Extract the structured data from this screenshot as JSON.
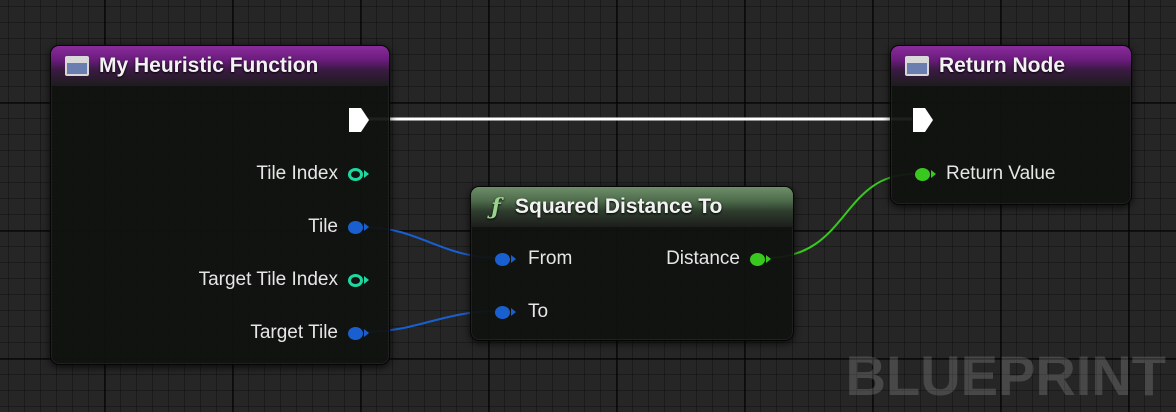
{
  "watermark": "BLUEPRINT",
  "entry_node": {
    "title": "My Heuristic Function",
    "pins": [
      {
        "label": "Tile Index",
        "type": "integer",
        "color": "#1fd8a0",
        "filled": false
      },
      {
        "label": "Tile",
        "type": "vector",
        "color": "#1a5fd0",
        "filled": true
      },
      {
        "label": "Target Tile Index",
        "type": "integer",
        "color": "#1fd8a0",
        "filled": false
      },
      {
        "label": "Target Tile",
        "type": "vector",
        "color": "#1a5fd0",
        "filled": true
      }
    ]
  },
  "function_node": {
    "title": "Squared Distance To",
    "inputs": [
      {
        "label": "From",
        "color": "#1a5fd0"
      },
      {
        "label": "To",
        "color": "#1a5fd0"
      }
    ],
    "output": {
      "label": "Distance",
      "color": "#37c91e"
    }
  },
  "return_node": {
    "title": "Return Node",
    "pins": [
      {
        "label": "Return Value",
        "color": "#37c91e"
      }
    ]
  },
  "colors": {
    "exec_wire": "#ffffff",
    "vector_wire": "#1a5fd0",
    "float_wire": "#37c91e",
    "entry_header": "#7a1f8c",
    "function_header": "#5a7a56"
  }
}
